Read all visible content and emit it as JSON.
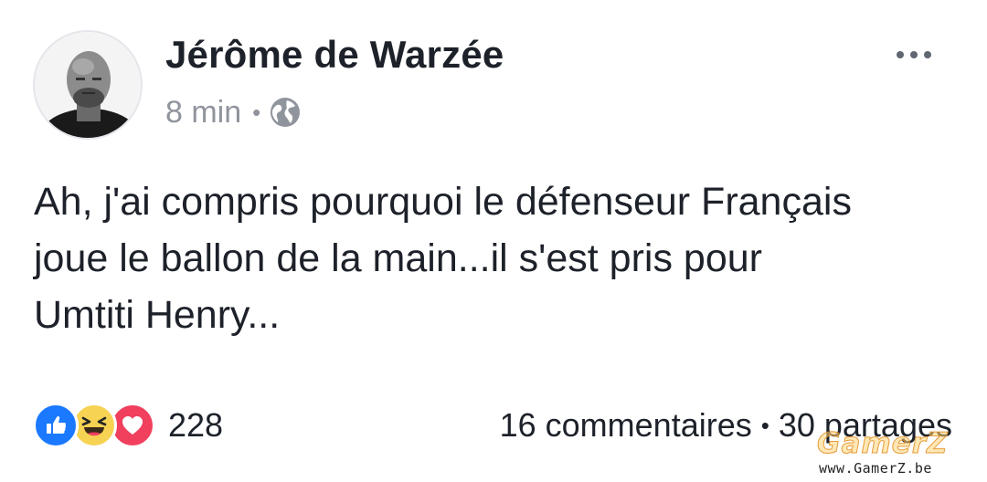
{
  "post": {
    "author": "Jérôme de Warzée",
    "timestamp": "8 min",
    "separator": "•",
    "audience_icon": "globe-icon",
    "more_icon": "more-dots-icon",
    "text_lines": [
      "Ah, j'ai compris pourquoi le défenseur Français",
      "joue le ballon de la main...il s'est pris pour",
      "Umtiti Henry..."
    ]
  },
  "reactions": {
    "icons": [
      "like-icon",
      "haha-icon",
      "love-icon"
    ],
    "count": "228"
  },
  "engagement": {
    "comments": "16 commentaires",
    "separator": "•",
    "shares": "30 partages"
  },
  "watermark": {
    "logo": "GamerZ",
    "url": "www.GamerZ.be"
  },
  "colors": {
    "text": "#1d2129",
    "meta": "#90949c",
    "like": "#1a79ff",
    "haha": "#f7d354",
    "love": "#f0405e"
  }
}
